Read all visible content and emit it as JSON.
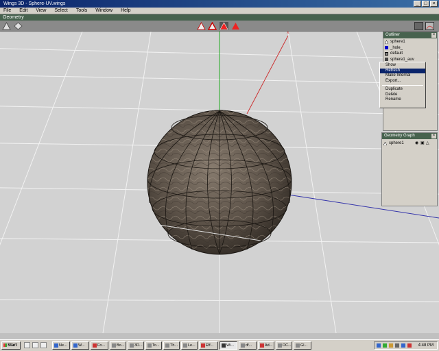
{
  "window": {
    "title": "Wings 3D - Sphere-UV.wings",
    "controls": [
      "_",
      "□",
      "×"
    ]
  },
  "menu": [
    "File",
    "Edit",
    "View",
    "Select",
    "Tools",
    "Window",
    "Help"
  ],
  "geometry_bar": "Geometry",
  "toolbar": {
    "left_tools": [
      "view-icon",
      "ortho-icon"
    ],
    "mode_tools": [
      "vertex-mode-icon",
      "edge-mode-icon",
      "face-mode-icon",
      "body-mode-icon"
    ],
    "right_tools": [
      "smooth-icon",
      "light-icon"
    ]
  },
  "axes": {
    "x_label": "x"
  },
  "outliner": {
    "title": "Outliner",
    "items": [
      {
        "label": "sphere1",
        "icon": "object-icon",
        "color": "#ffffff"
      },
      {
        "label": "_hole_",
        "icon": "material-icon",
        "color": "#0000cc"
      },
      {
        "label": "default",
        "icon": "material-icon",
        "color": "#888888"
      },
      {
        "label": "sphere1_auv",
        "icon": "image-icon",
        "color": "#444444"
      }
    ]
  },
  "context_menu": {
    "items": [
      "Show",
      "Refresh",
      "Make Internal",
      "Export...",
      "Duplicate",
      "Delete",
      "Rename"
    ],
    "selected": "Refresh"
  },
  "geometry_graph": {
    "title": "Geometry Graph",
    "items": [
      {
        "label": "sphere1"
      }
    ]
  },
  "taskbar": {
    "start": "Start",
    "buttons": [
      "Ne...",
      "W...",
      "Fo...",
      "Bo...",
      "3D...",
      "To...",
      "Th...",
      "Le...",
      "Eff...",
      "Wi...",
      "df...",
      "Ad...",
      "DC...",
      "Gl..."
    ],
    "active": "Wi...",
    "clock": "4:48 PM"
  },
  "colors": {
    "title_bg": "#0a246a",
    "panel_title_bg": "#47624e",
    "viewport_bg": "#d2d2d2",
    "highlight": "#0a246a",
    "sphere": "#5c5248"
  }
}
